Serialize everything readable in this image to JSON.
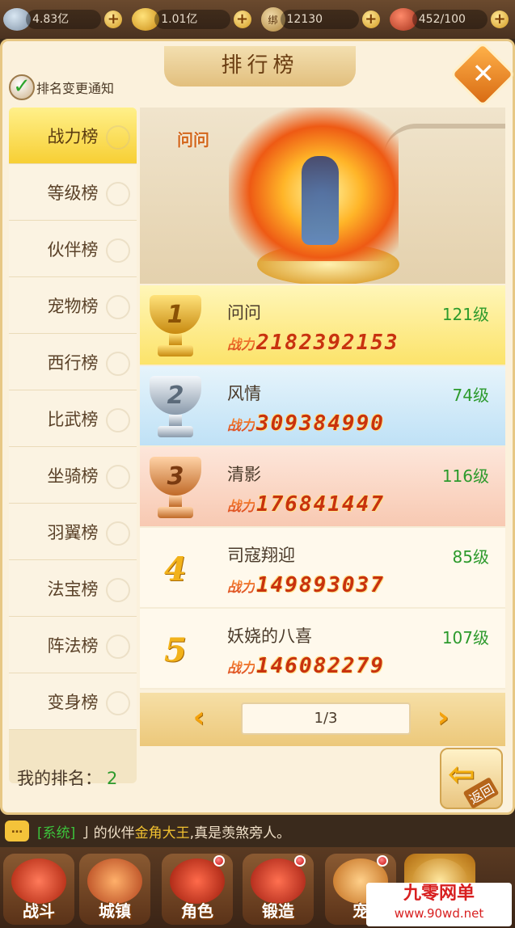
{
  "resources": [
    {
      "icon": "silver-ingot-icon",
      "value": "4.83亿"
    },
    {
      "icon": "gold-ingot-icon",
      "value": "1.01亿"
    },
    {
      "icon": "bound-gold-icon",
      "badge": "绑",
      "value": "12130"
    },
    {
      "icon": "stamina-icon",
      "value": "452/100"
    }
  ],
  "panel": {
    "title": "排行榜",
    "notify_label": "排名变更通知",
    "notify_checked": true
  },
  "tabs": [
    {
      "label": "战力榜",
      "active": true
    },
    {
      "label": "等级榜"
    },
    {
      "label": "伙伴榜"
    },
    {
      "label": "宠物榜"
    },
    {
      "label": "西行榜"
    },
    {
      "label": "比武榜"
    },
    {
      "label": "坐骑榜"
    },
    {
      "label": "羽翼榜"
    },
    {
      "label": "法宝榜"
    },
    {
      "label": "阵法榜"
    },
    {
      "label": "变身榜"
    }
  ],
  "showcase": {
    "name": "问问"
  },
  "ranking": {
    "power_prefix": "战力",
    "rows": [
      {
        "rank": "1",
        "name": "问问",
        "level": "121级",
        "power": "2182392153"
      },
      {
        "rank": "2",
        "name": "风情",
        "level": "74级",
        "power": "309384990"
      },
      {
        "rank": "3",
        "name": "清影",
        "level": "116级",
        "power": "176841447"
      },
      {
        "rank": "4",
        "name": "司寇翔迎",
        "level": "85级",
        "power": "149893037"
      },
      {
        "rank": "5",
        "name": "妖娆的八喜",
        "level": "107级",
        "power": "146082279"
      }
    ]
  },
  "pager": {
    "page": "1/3",
    "prev": "‹",
    "next": "›"
  },
  "my_rank": {
    "label": "我的排名：",
    "value": "2"
  },
  "back": {
    "label": "返回",
    "arrow": "⇦"
  },
  "chat": {
    "icon": "…",
    "channel": "[系统]",
    "text_a": "亅的伙伴",
    "highlight": "金角大王",
    "text_b": ",真是羡煞旁人。"
  },
  "nav": [
    {
      "label": "战斗",
      "badge": false
    },
    {
      "label": "城镇",
      "badge": false
    },
    {
      "label": "角色",
      "badge": true
    },
    {
      "label": "锻造",
      "badge": true
    },
    {
      "label": "宠",
      "badge": true
    }
  ],
  "watermark": {
    "line1": "九零网单",
    "line2": "www.90wd.net"
  },
  "colors": {
    "level_green": "#2c9a2c",
    "power_red": "#c8320e",
    "active_tab": "#f7cf34"
  }
}
